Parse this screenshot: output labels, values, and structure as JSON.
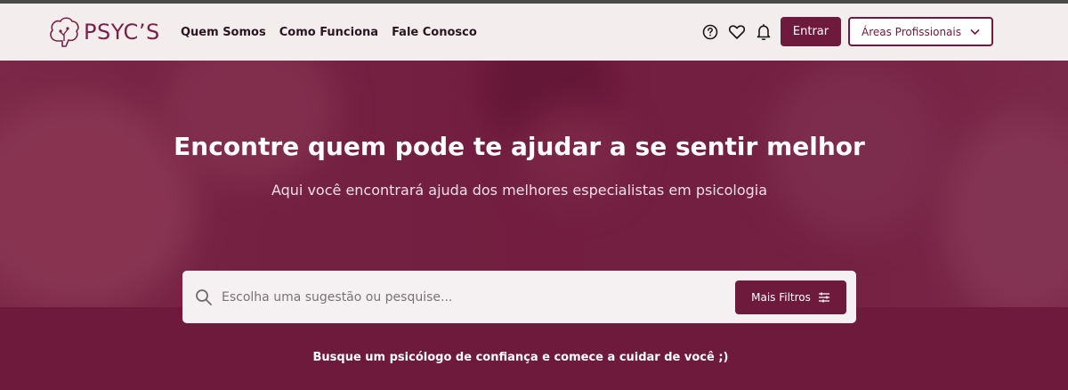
{
  "brand": {
    "name": "PSYC’S"
  },
  "nav": {
    "items": [
      {
        "label": "Quem Somos"
      },
      {
        "label": "Como Funciona"
      },
      {
        "label": "Fale Conosco"
      }
    ]
  },
  "header_actions": {
    "help_icon": "question-circle-icon",
    "favorites_icon": "heart-icon",
    "notifications_icon": "bell-icon",
    "login_label": "Entrar",
    "areas_label": "Áreas Profissionais"
  },
  "hero": {
    "title": "Encontre quem pode te ajudar a se sentir melhor",
    "subtitle": "Aqui você encontrará ajuda dos melhores especialistas em psicologia"
  },
  "search": {
    "placeholder": "Escolha uma sugestão ou pesquise...",
    "filters_label": "Mais Filtros"
  },
  "tagline": "Busque um psicólogo de confiança e comece a cuidar de você ;)",
  "colors": {
    "brand": "#6e1a3c",
    "header_bg": "#f3eded",
    "text_dark": "#2a1520"
  }
}
